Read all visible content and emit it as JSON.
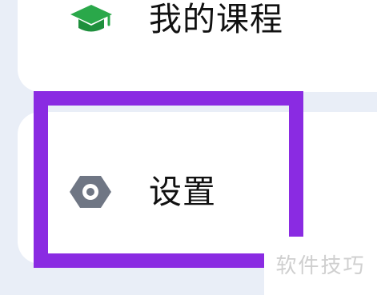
{
  "menu": {
    "items": [
      {
        "label": "我的课程",
        "icon": "graduation-cap-icon",
        "icon_color": "#2aa84a"
      },
      {
        "label": "设置",
        "icon": "gear-icon",
        "icon_color": "#6f7684"
      }
    ]
  },
  "highlight": {
    "color": "#8a2be2"
  },
  "watermark": {
    "text": "软件技巧"
  }
}
